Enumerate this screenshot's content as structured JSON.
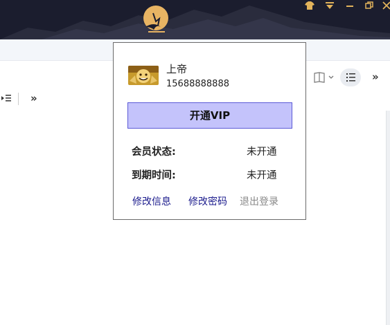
{
  "window": {
    "controls": {
      "skin": "skin-icon",
      "menu": "menu-icon",
      "minimize": "minimize-icon",
      "maximize": "restore-icon",
      "close": "close-icon"
    }
  },
  "background": {
    "left_double_arrow": "»",
    "right_double_arrow": "»"
  },
  "popup": {
    "user": {
      "name": "上帝",
      "phone": "15688888888"
    },
    "vip_button": "开通VIP",
    "status_label": "会员状态:",
    "status_value": "未开通",
    "expire_label": "到期时间:",
    "expire_value": "未开通",
    "links": {
      "edit_info": "修改信息",
      "change_password": "修改密码",
      "logout": "退出登录"
    }
  },
  "colors": {
    "header_bg": "#1b1d2e",
    "accent_gold": "#e2b35b",
    "vip_bg": "#c4c3fb",
    "vip_border": "#5b5ad6",
    "link": "#1a1a8c",
    "logout": "#888888"
  }
}
